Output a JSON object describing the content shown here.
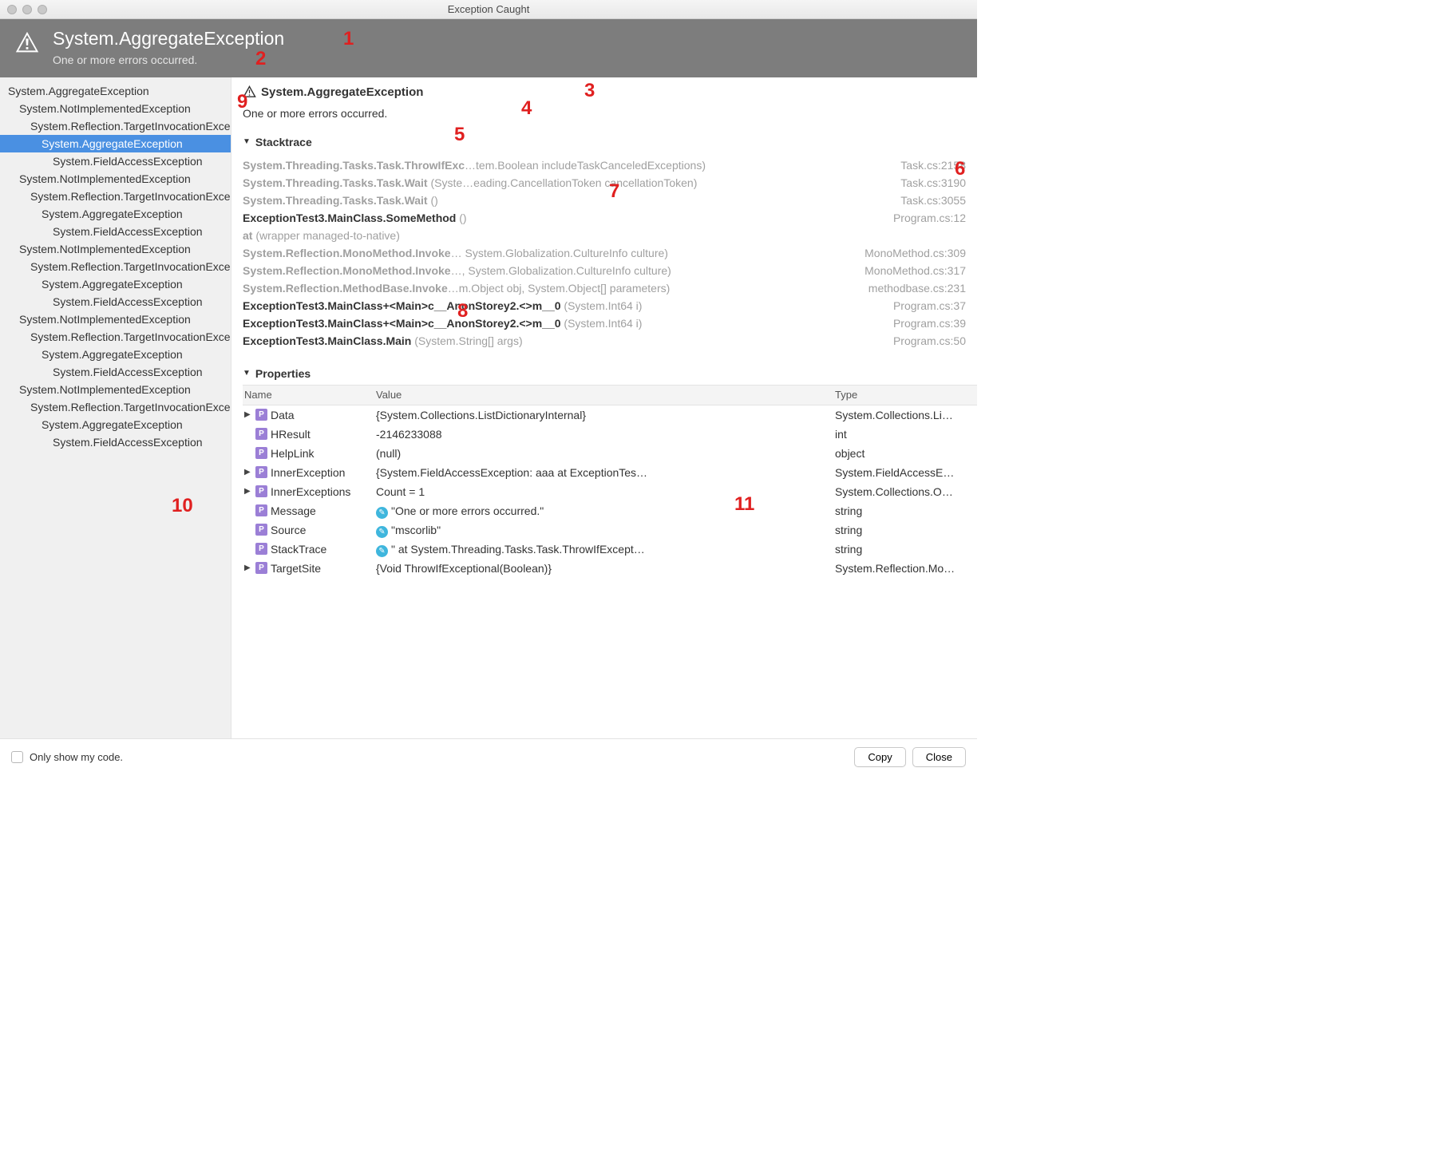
{
  "window": {
    "title": "Exception Caught"
  },
  "header": {
    "title": "System.AggregateException",
    "subtitle": "One or more errors occurred."
  },
  "tree": {
    "items": [
      {
        "label": "System.AggregateException",
        "indent": 0,
        "selected": false
      },
      {
        "label": "System.NotImplementedException",
        "indent": 1,
        "selected": false
      },
      {
        "label": "System.Reflection.TargetInvocationException",
        "indent": 2,
        "selected": false
      },
      {
        "label": "System.AggregateException",
        "indent": 3,
        "selected": true
      },
      {
        "label": "System.FieldAccessException",
        "indent": 4,
        "selected": false
      },
      {
        "label": "System.NotImplementedException",
        "indent": 1,
        "selected": false
      },
      {
        "label": "System.Reflection.TargetInvocationException",
        "indent": 2,
        "selected": false
      },
      {
        "label": "System.AggregateException",
        "indent": 3,
        "selected": false
      },
      {
        "label": "System.FieldAccessException",
        "indent": 4,
        "selected": false
      },
      {
        "label": "System.NotImplementedException",
        "indent": 1,
        "selected": false
      },
      {
        "label": "System.Reflection.TargetInvocationException",
        "indent": 2,
        "selected": false
      },
      {
        "label": "System.AggregateException",
        "indent": 3,
        "selected": false
      },
      {
        "label": "System.FieldAccessException",
        "indent": 4,
        "selected": false
      },
      {
        "label": "System.NotImplementedException",
        "indent": 1,
        "selected": false
      },
      {
        "label": "System.Reflection.TargetInvocationException",
        "indent": 2,
        "selected": false
      },
      {
        "label": "System.AggregateException",
        "indent": 3,
        "selected": false
      },
      {
        "label": "System.FieldAccessException",
        "indent": 4,
        "selected": false
      },
      {
        "label": "System.NotImplementedException",
        "indent": 1,
        "selected": false
      },
      {
        "label": "System.Reflection.TargetInvocationException",
        "indent": 2,
        "selected": false
      },
      {
        "label": "System.AggregateException",
        "indent": 3,
        "selected": false
      },
      {
        "label": "System.FieldAccessException",
        "indent": 4,
        "selected": false
      }
    ]
  },
  "detail": {
    "title": "System.AggregateException",
    "subtitle": "One or more errors occurred."
  },
  "sections": {
    "stacktrace_label": "Stacktrace",
    "properties_label": "Properties"
  },
  "stacktrace": [
    {
      "method": "System.Threading.Tasks.Task.ThrowIfExc",
      "args": "…tem.Boolean includeTaskCanceledExceptions)",
      "loc": "Task.cs:2158",
      "user": false
    },
    {
      "method": "System.Threading.Tasks.Task.Wait",
      "args": " (Syste…eading.CancellationToken cancellationToken)",
      "loc": "Task.cs:3190",
      "user": false
    },
    {
      "method": "System.Threading.Tasks.Task.Wait",
      "args": " ()",
      "loc": "Task.cs:3055",
      "user": false
    },
    {
      "method": "ExceptionTest3.MainClass.SomeMethod",
      "args": " ()",
      "loc": "Program.cs:12",
      "user": true
    },
    {
      "at": "at",
      "args": " (wrapper managed-to-native)",
      "loc": "",
      "user": false,
      "isat": true
    },
    {
      "method": "System.Reflection.MonoMethod.Invoke",
      "args": "…  System.Globalization.CultureInfo culture)",
      "loc": "MonoMethod.cs:309",
      "user": false
    },
    {
      "method": "System.Reflection.MonoMethod.Invoke",
      "args": "…, System.Globalization.CultureInfo culture)",
      "loc": "MonoMethod.cs:317",
      "user": false
    },
    {
      "method": "System.Reflection.MethodBase.Invoke",
      "args": "…m.Object obj, System.Object[] parameters)",
      "loc": "methodbase.cs:231",
      "user": false
    },
    {
      "method": "ExceptionTest3.MainClass+<Main>c__AnonStorey2.<>m__0",
      "args": " (System.Int64 i)",
      "loc": "Program.cs:37",
      "user": true
    },
    {
      "method": "ExceptionTest3.MainClass+<Main>c__AnonStorey2.<>m__0",
      "args": " (System.Int64 i)",
      "loc": "Program.cs:39",
      "user": true
    },
    {
      "method": "ExceptionTest3.MainClass.Main",
      "args": " (System.String[] args)",
      "loc": "Program.cs:50",
      "user": true
    }
  ],
  "properties": {
    "headers": {
      "name": "Name",
      "value": "Value",
      "type": "Type"
    },
    "rows": [
      {
        "expandable": true,
        "name": "Data",
        "value": "{System.Collections.ListDictionaryInternal}",
        "type": "System.Collections.Li…",
        "badge": "P"
      },
      {
        "expandable": false,
        "name": "HResult",
        "value": "-2146233088",
        "type": "int",
        "badge": "P"
      },
      {
        "expandable": false,
        "name": "HelpLink",
        "value": "(null)",
        "type": "object",
        "badge": "P"
      },
      {
        "expandable": true,
        "name": "InnerException",
        "value": "{System.FieldAccessException: aaa   at ExceptionTes…",
        "type": "System.FieldAccessE…",
        "badge": "P"
      },
      {
        "expandable": true,
        "name": "InnerExceptions",
        "value": "Count = 1",
        "type": "System.Collections.O…",
        "badge": "P"
      },
      {
        "expandable": false,
        "name": "Message",
        "value": "\"One or more errors occurred.\"",
        "type": "string",
        "badge": "P",
        "valicon": true
      },
      {
        "expandable": false,
        "name": "Source",
        "value": "\"mscorlib\"",
        "type": "string",
        "badge": "P",
        "valicon": true
      },
      {
        "expandable": false,
        "name": "StackTrace",
        "value": "\"  at System.Threading.Tasks.Task.ThrowIfExcept…",
        "type": "string",
        "badge": "P",
        "valicon": true
      },
      {
        "expandable": true,
        "name": "TargetSite",
        "value": "{Void ThrowIfExceptional(Boolean)}",
        "type": "System.Reflection.Mo…",
        "badge": "P"
      }
    ]
  },
  "footer": {
    "only_my_code": "Only show my code.",
    "copy": "Copy",
    "close": "Close"
  },
  "annotations": {
    "1": "1",
    "2": "2",
    "3": "3",
    "4": "4",
    "5": "5",
    "6": "6",
    "7": "7",
    "8": "8",
    "9": "9",
    "10": "10",
    "11": "11"
  }
}
